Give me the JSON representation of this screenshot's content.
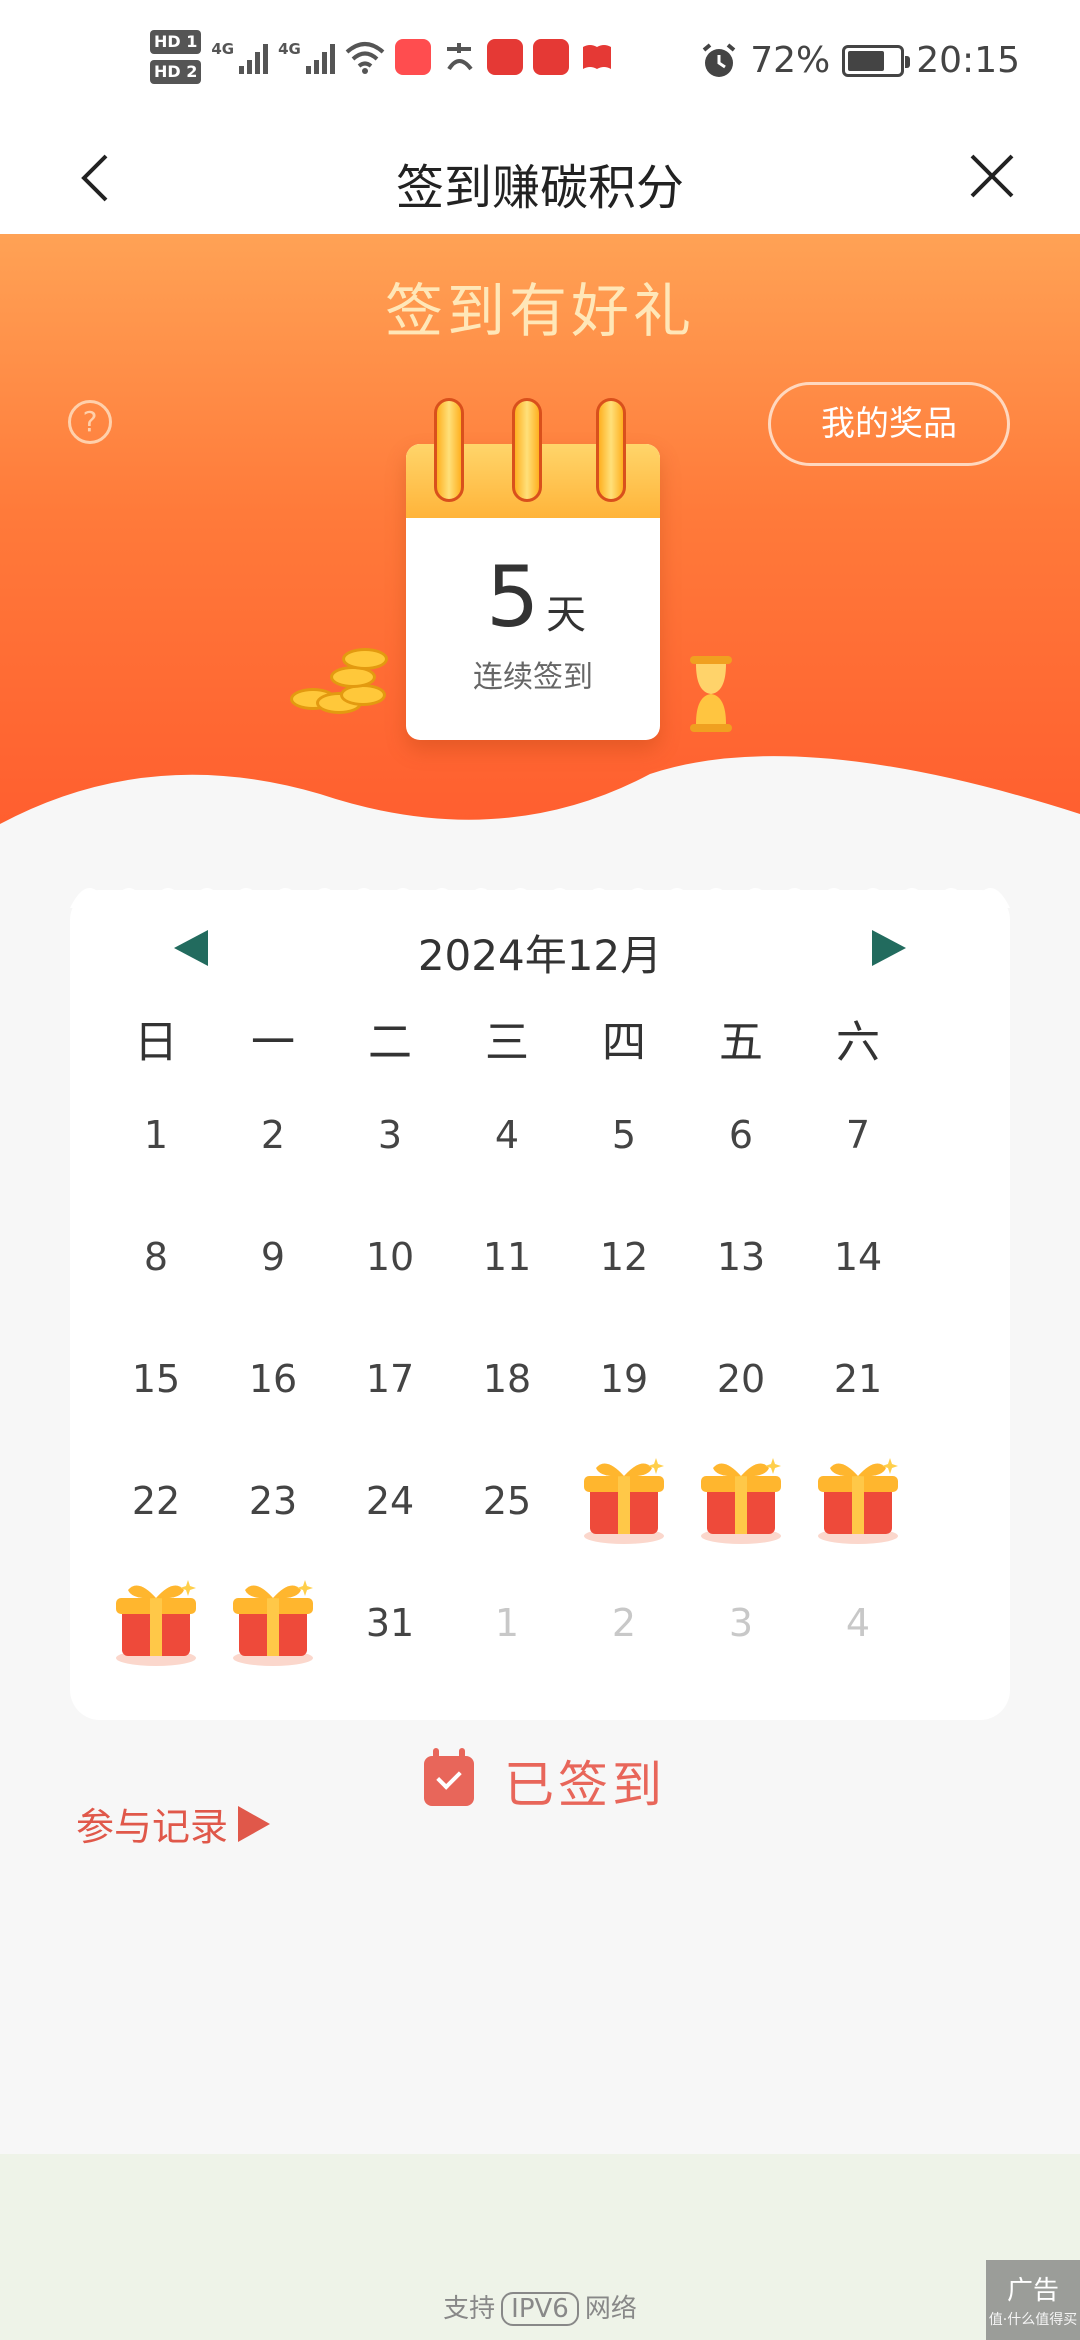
{
  "status_bar": {
    "hd1": "HD 1",
    "hd2": "HD 2",
    "network1": "4G",
    "network2": "4G",
    "battery_percent": "72%",
    "battery_level": 0.72,
    "time": "20:15"
  },
  "nav": {
    "title": "签到赚碳积分"
  },
  "hero": {
    "title": "签到有好礼",
    "help_label": "?",
    "prize_button": "我的奖品",
    "streak_number": "5",
    "streak_unit": "天",
    "streak_label": "连续签到"
  },
  "calendar": {
    "month": "2024年12月",
    "weekdays": [
      "日",
      "一",
      "二",
      "三",
      "四",
      "五",
      "六"
    ]
  },
  "actions": {
    "signed_label": "已签到",
    "record_label": "参与记录"
  },
  "footer": {
    "ipv6_prefix": "支持",
    "ipv6_badge": "IPV6",
    "ipv6_suffix": "网络",
    "ad_label": "广告",
    "ad_watermark": "值·什么值得买"
  },
  "colors": {
    "hero_orange": "#ff6a34",
    "accent_teal": "#226b5e",
    "signed_red": "#e8665a"
  }
}
